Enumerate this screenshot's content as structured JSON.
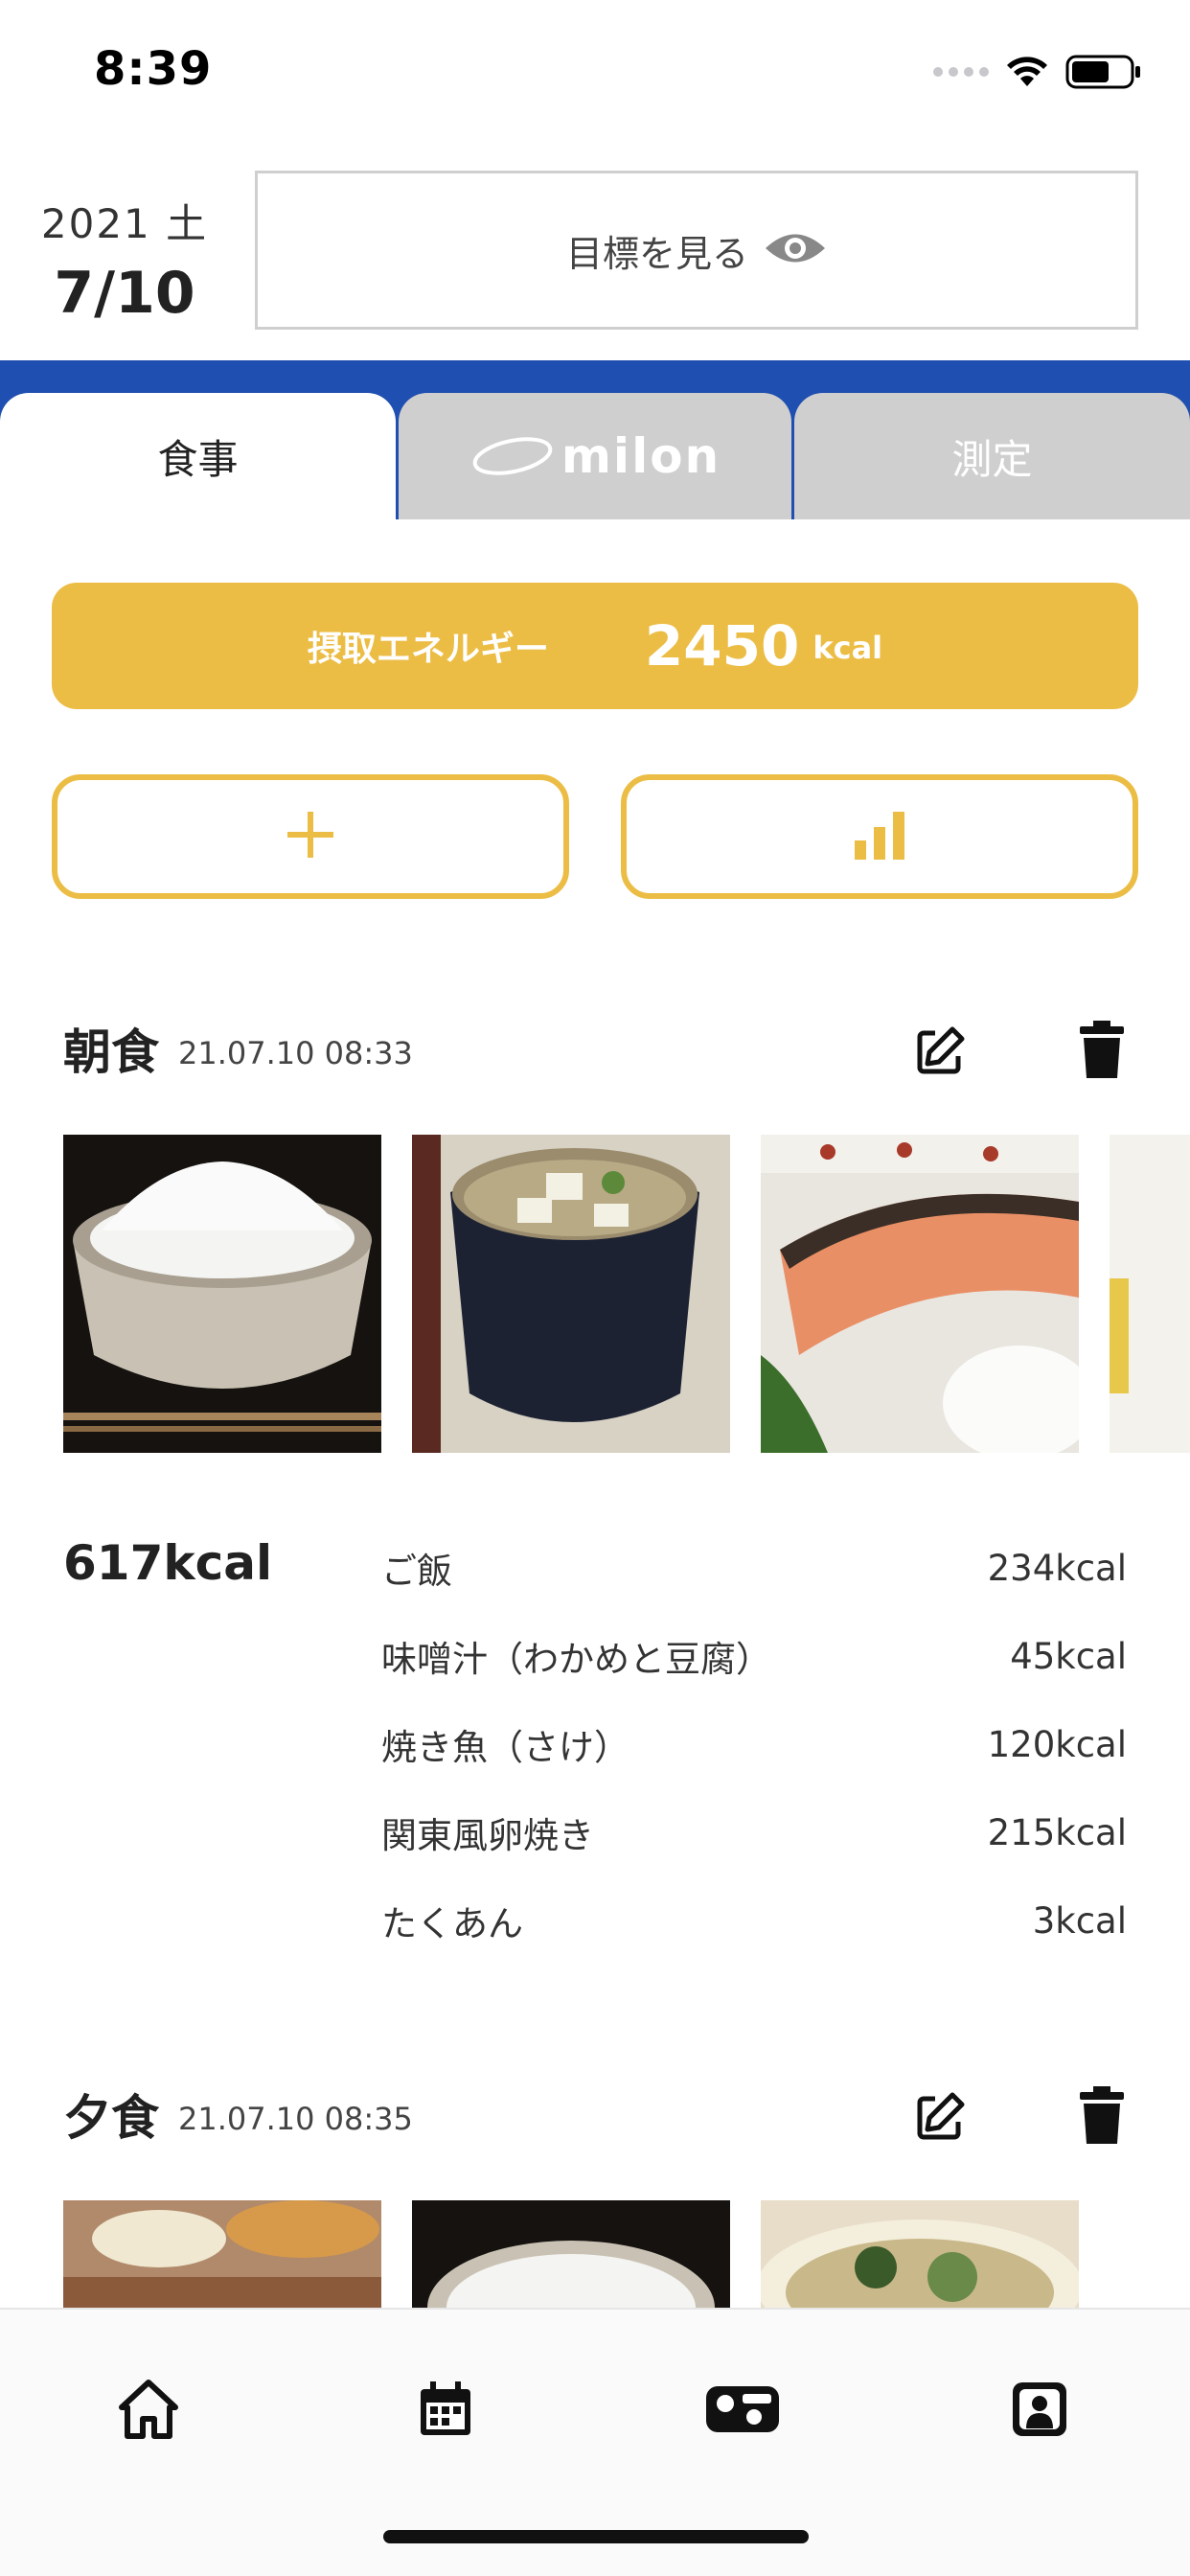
{
  "status_bar": {
    "time": "8:39"
  },
  "header": {
    "year_day": "2021 土",
    "month_day": "7/10",
    "goal_button_label": "目標を見る"
  },
  "tabs": [
    {
      "label": "食事",
      "active": true
    },
    {
      "label": "milon",
      "active": false
    },
    {
      "label": "測定",
      "active": false
    }
  ],
  "energy": {
    "label": "摂取エネルギー",
    "value": "2450",
    "unit": "kcal"
  },
  "actions": {
    "add_icon": "plus-icon",
    "stats_icon": "bar-chart-icon"
  },
  "meals": [
    {
      "title": "朝食",
      "timestamp": "21.07.10 08:33",
      "total": "617kcal",
      "photos": [
        "rice-bowl",
        "miso-soup",
        "grilled-salmon"
      ],
      "items": [
        {
          "name": "ご飯",
          "kcal": "234kcal"
        },
        {
          "name": "味噌汁（わかめと豆腐）",
          "kcal": "45kcal"
        },
        {
          "name": "焼き魚（さけ）",
          "kcal": "120kcal"
        },
        {
          "name": "関東風卵焼き",
          "kcal": "215kcal"
        },
        {
          "name": "たくあん",
          "kcal": "3kcal"
        }
      ]
    },
    {
      "title": "夕食",
      "timestamp": "21.07.10 08:35",
      "photos": [
        "grilled-vegetables",
        "rice-bowl",
        "vegetable-soup"
      ]
    }
  ],
  "nav": [
    "home-icon",
    "calendar-icon",
    "meal-icon",
    "profile-icon"
  ],
  "colors": {
    "accent": "#ecbd45",
    "tab_bar": "#1f4fb0",
    "inactive_tab": "#cfcfcf"
  }
}
